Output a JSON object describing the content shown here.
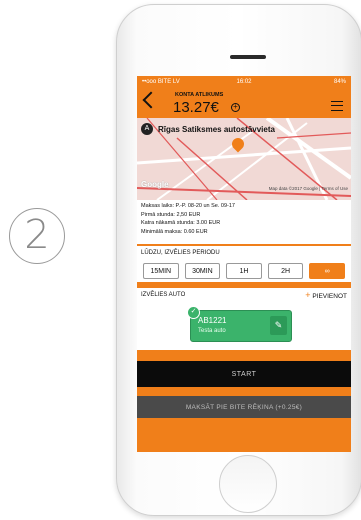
{
  "step_number": "2",
  "status_bar": {
    "carrier": "••ooo BITE LV",
    "time": "16:02",
    "battery": "84%"
  },
  "header": {
    "account_label": "KONTA ATLIKUMS",
    "balance": "13.27€"
  },
  "location": {
    "badge": "A",
    "name": "Rīgas Satiksmes autostāvvieta"
  },
  "map": {
    "google_label": "Google",
    "attribution": "Map data ©2017 Google | Terms of Use"
  },
  "info_lines": [
    "Maksas laiks: P.-P. 08-20 un Se. 09-17",
    "Pirmā stunda: 2,50 EUR",
    "Katra nākamā stunda: 3.00 EUR",
    "Minimālā maksa: 0.60 EUR"
  ],
  "period": {
    "heading": "LŪDZU, IZVĒLIES PERIODU",
    "options": [
      "15MIN",
      "30MIN",
      "1H",
      "2H",
      "∞"
    ],
    "selected": "∞"
  },
  "car": {
    "heading": "IZVĒLIES AUTO",
    "add_label": "PIEVIENOT",
    "plate": "AB1221",
    "description": "Testa auto"
  },
  "buttons": {
    "start": "START",
    "pay_bite": "MAKSĀT PIE BITE RĒĶINA (+0.25€)"
  },
  "colors": {
    "accent": "#f07f1a",
    "car_green": "#3bb36b",
    "start_bg": "#0b0b0b"
  }
}
